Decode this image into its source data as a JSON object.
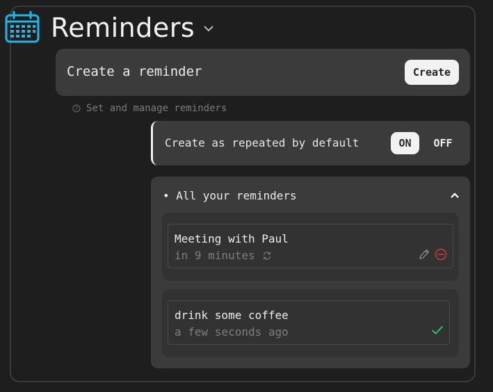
{
  "app": {
    "title": "Reminders"
  },
  "create": {
    "label": "Create a reminder",
    "button": "Create"
  },
  "hint": {
    "text": "Set and manage reminders"
  },
  "repeat": {
    "label": "Create as repeated by default",
    "on": "ON",
    "off": "OFF",
    "selected": "ON"
  },
  "list": {
    "header": "• All your reminders",
    "items": [
      {
        "title": "Meeting with Paul",
        "time": "in 9 minutes",
        "repeating": true,
        "status": "upcoming"
      },
      {
        "title": "drink some coffee",
        "time": "a few seconds ago",
        "repeating": false,
        "status": "done"
      }
    ]
  },
  "colors": {
    "accent": "#1fb6e8",
    "delete": "#d23c3c",
    "done": "#2ecc71",
    "background": "#1e1e1e",
    "card": "#3b3b3b"
  },
  "icons": [
    "calendar-icon",
    "chevron-down-icon",
    "help-circle-icon",
    "chevron-up-icon",
    "repeat-icon",
    "edit-icon",
    "delete-icon",
    "check-icon"
  ]
}
